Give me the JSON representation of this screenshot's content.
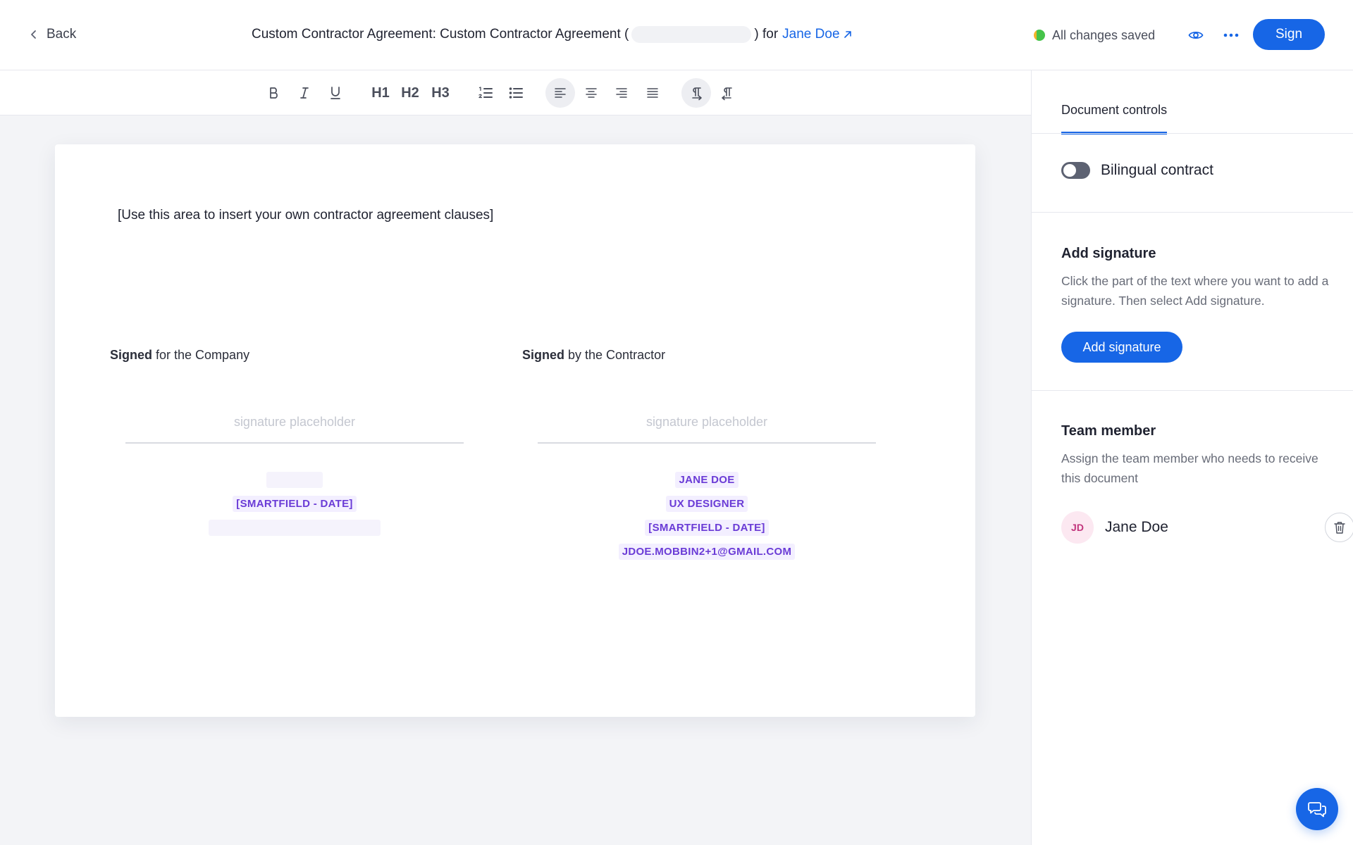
{
  "header": {
    "back_label": "Back",
    "title_prefix": "Custom Contractor Agreement: Custom Contractor Agreement (",
    "title_suffix": ") for",
    "recipient_link": "Jane Doe",
    "save_status": "All changes saved",
    "sign_label": "Sign"
  },
  "toolbar": {
    "h1": "H1",
    "h2": "H2",
    "h3": "H3"
  },
  "document": {
    "clause_placeholder": "[Use this area to insert your own contractor agreement clauses]",
    "company": {
      "signed_bold": "Signed",
      "signed_rest": " for the Company",
      "signature_placeholder": "signature placeholder",
      "date_field": "[SMARTFIELD - DATE]"
    },
    "contractor": {
      "signed_bold": "Signed",
      "signed_rest": " by the Contractor",
      "signature_placeholder": "signature placeholder",
      "name_field": "JANE DOE",
      "role_field": "UX DESIGNER",
      "date_field": "[SMARTFIELD - DATE]",
      "email_field": "JDOE.MOBBIN2+1@GMAIL.COM"
    }
  },
  "side_panel": {
    "tab_label": "Document controls",
    "bilingual_label": "Bilingual contract",
    "bilingual_on": false,
    "add_signature": {
      "title": "Add signature",
      "description": "Click the part of the text where you want to add a signature. Then select Add signature.",
      "button_label": "Add signature"
    },
    "team_member": {
      "title": "Team member",
      "description": "Assign the team member who needs to receive this document",
      "initials": "JD",
      "name": "Jane Doe"
    }
  },
  "colors": {
    "accent": "#1766e6",
    "smartfield_text": "#6a3bd6",
    "smartfield_bg": "#f3efff",
    "avatar_bg": "#fce8f1",
    "avatar_text": "#c2357d"
  },
  "icons": {
    "back": "chevron-left-icon",
    "external": "arrow-up-right-icon",
    "preview": "eye-icon",
    "more": "more-horizontal-icon",
    "delete": "trash-icon",
    "chat": "chat-bubbles-icon"
  }
}
